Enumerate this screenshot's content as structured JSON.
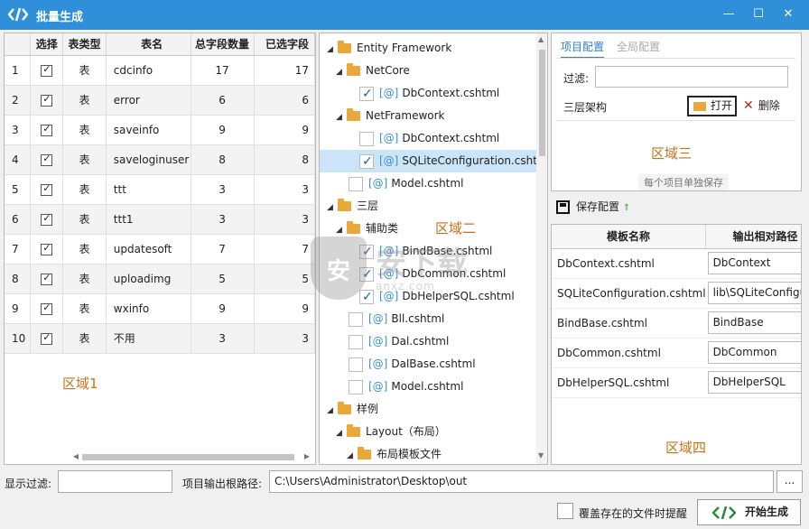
{
  "window": {
    "title": "批量生成",
    "buttons": {
      "minimize": "—",
      "maximize": "☐",
      "close": "✕"
    }
  },
  "grid": {
    "columns": [
      "",
      "选择",
      "表类型",
      "表名",
      "总字段数量",
      "已选字段"
    ],
    "rows": [
      {
        "idx": "1",
        "checked": true,
        "type": "表",
        "name": "cdcinfo",
        "total": "17",
        "selected": "17"
      },
      {
        "idx": "2",
        "checked": true,
        "type": "表",
        "name": "error",
        "total": "6",
        "selected": "6"
      },
      {
        "idx": "3",
        "checked": true,
        "type": "表",
        "name": "saveinfo",
        "total": "9",
        "selected": "9"
      },
      {
        "idx": "4",
        "checked": true,
        "type": "表",
        "name": "saveloginuser",
        "total": "8",
        "selected": "8"
      },
      {
        "idx": "5",
        "checked": true,
        "type": "表",
        "name": "ttt",
        "total": "3",
        "selected": "3"
      },
      {
        "idx": "6",
        "checked": true,
        "type": "表",
        "name": "ttt1",
        "total": "3",
        "selected": "3"
      },
      {
        "idx": "7",
        "checked": true,
        "type": "表",
        "name": "updatesoft",
        "total": "7",
        "selected": "7"
      },
      {
        "idx": "8",
        "checked": true,
        "type": "表",
        "name": "uploadimg",
        "total": "5",
        "selected": "5"
      },
      {
        "idx": "9",
        "checked": true,
        "type": "表",
        "name": "wxinfo",
        "total": "9",
        "selected": "9"
      },
      {
        "idx": "10",
        "checked": true,
        "type": "表",
        "name": "不用",
        "total": "3",
        "selected": "3"
      }
    ],
    "area_label": "区域1"
  },
  "tree": {
    "area_label": "区域二",
    "nodes": {
      "n0": "Entity Framework",
      "n1": "NetCore",
      "n2": "DbContext.cshtml",
      "n3": "NetFramework",
      "n4": "DbContext.cshtml",
      "n5": "SQLiteConfiguration.cshtml",
      "n6": "Model.cshtml",
      "n7": "三层",
      "n8": "辅助类",
      "n9": "BindBase.cshtml",
      "n10": "DbCommon.cshtml",
      "n11": "DbHelperSQL.cshtml",
      "n12": "Bll.cshtml",
      "n13": "Dal.cshtml",
      "n14": "DalBase.cshtml",
      "n15": "Model.cshtml",
      "n16": "样例",
      "n17": "Layout（布局）",
      "n18": "布局模板文件"
    },
    "at": "[@]"
  },
  "config": {
    "tabs": [
      "项目配置",
      "全局配置"
    ],
    "filter_label": "过滤:",
    "filter_value": "",
    "layer_label": "三层架构",
    "open_label": "打开",
    "delete_label": "删除",
    "area_label": "区域三",
    "save_hint": "每个项目单独保存"
  },
  "save_config": {
    "label": "保存配置",
    "arrow": "⇑"
  },
  "templates": {
    "columns": [
      "模板名称",
      "输出相对路径"
    ],
    "rows": [
      {
        "name": "DbContext.cshtml",
        "path": "DbContext"
      },
      {
        "name": "SQLiteConfiguration.cshtml",
        "path": "lib\\SQLiteConfiguration"
      },
      {
        "name": "BindBase.cshtml",
        "path": "BindBase"
      },
      {
        "name": "DbCommon.cshtml",
        "path": "DbCommon"
      },
      {
        "name": "DbHelperSQL.cshtml",
        "path": "DbHelperSQL"
      }
    ],
    "area_label": "区域四"
  },
  "bottom": {
    "filter_label": "显示过滤:",
    "filter_value": "",
    "root_label": "项目输出根路径:",
    "root_value": "C:\\Users\\Administrator\\Desktop\\out",
    "browse_label": "...",
    "overwrite_label": "覆盖存在的文件时提醒",
    "generate_label": "开始生成"
  },
  "watermark": {
    "main": "安下载",
    "sub": "anxz.com",
    "shield": "安"
  },
  "colors": {
    "titlebar": "#2f8fd8",
    "accent": "#2f7fc8",
    "area_label": "#c8701a",
    "folder": "#e8a93a"
  }
}
